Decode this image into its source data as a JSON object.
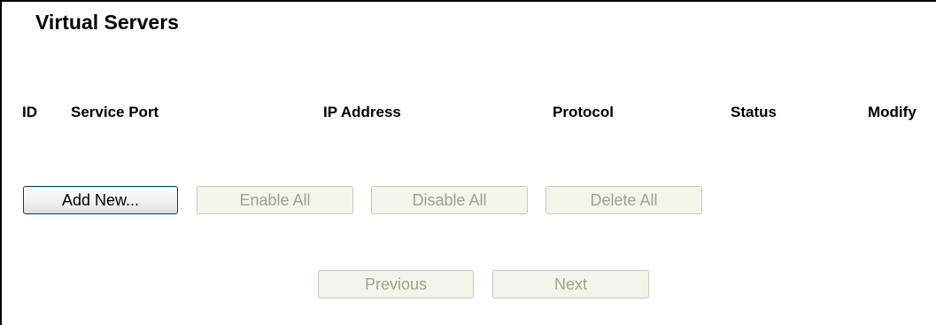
{
  "page": {
    "title": "Virtual Servers"
  },
  "table": {
    "headers": {
      "id": "ID",
      "service_port": "Service Port",
      "ip_address": "IP Address",
      "protocol": "Protocol",
      "status": "Status",
      "modify": "Modify"
    },
    "rows": []
  },
  "actions": {
    "add_new": "Add New...",
    "enable_all": "Enable All",
    "disable_all": "Disable All",
    "delete_all": "Delete All"
  },
  "pagination": {
    "previous": "Previous",
    "next": "Next"
  }
}
